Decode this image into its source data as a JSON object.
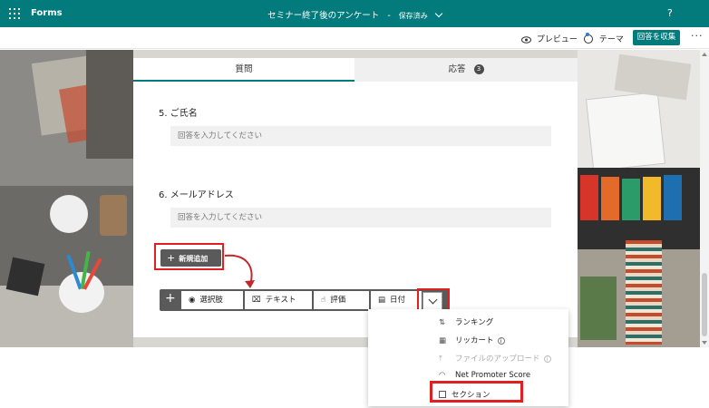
{
  "header": {
    "app_name": "Forms",
    "doc_title": "セミナー終了後のアンケート",
    "separator": "-",
    "save_status": "保存済み",
    "help": "?"
  },
  "commandbar": {
    "preview": "プレビュー",
    "theme": "テーマ",
    "collect": "回答を収集",
    "more": "···"
  },
  "tabs": {
    "questions": "質問",
    "responses": "応答",
    "response_count": "3"
  },
  "questions": [
    {
      "label": "5. ご氏名",
      "placeholder": "回答を入力してください"
    },
    {
      "label": "6. メールアドレス",
      "placeholder": "回答を入力してください"
    }
  ],
  "add_new": "新規追加",
  "toolbar": {
    "choice": "選択肢",
    "text": "テキスト",
    "rating": "評価",
    "date": "日付"
  },
  "dropdown": {
    "ranking": "ランキング",
    "likert": "リッカート",
    "upload": "ファイルのアップロード",
    "nps": "Net Promoter Score",
    "section": "セクション"
  },
  "colors": {
    "brand": "#037b7d",
    "highlight": "#e02020"
  }
}
